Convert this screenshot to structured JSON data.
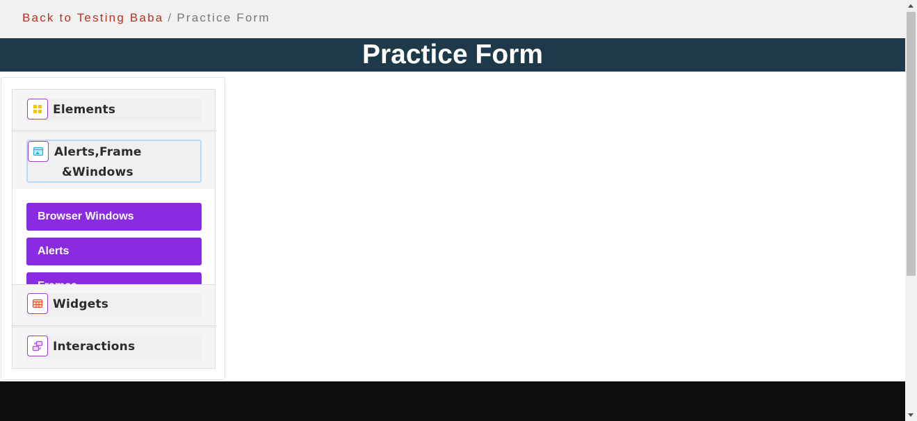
{
  "breadcrumb": {
    "link": "Back to Testing Baba",
    "separator": "/",
    "current": "Practice Form"
  },
  "header": {
    "title": "Practice Form"
  },
  "sidebar": {
    "groups": [
      {
        "label": "Elements",
        "icon": "grid-icon"
      },
      {
        "label_line1": "Alerts,Frame",
        "label_line2": "&Windows",
        "icon": "window-icon",
        "expanded": true
      },
      {
        "label": "Widgets",
        "icon": "widget-table-icon"
      },
      {
        "label": "Interactions",
        "icon": "interaction-icon"
      }
    ],
    "submenu": [
      {
        "label": "Browser Windows"
      },
      {
        "label": "Alerts"
      },
      {
        "label": "Frames"
      }
    ]
  },
  "colors": {
    "title_bar": "#1e3a4a",
    "accent_purple": "#8a2be2",
    "breadcrumb_link": "#b8321e",
    "footer": "#0e0e0e"
  }
}
